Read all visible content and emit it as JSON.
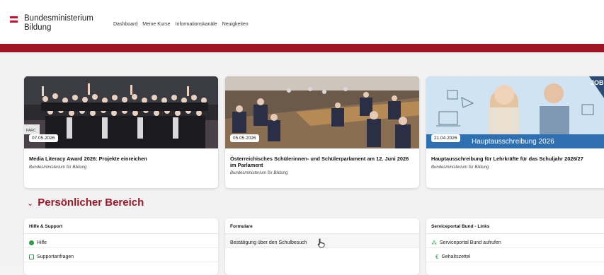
{
  "header": {
    "logo_line1": "Bundesministerium",
    "logo_line2": "Bildung",
    "nav": [
      "Dashboard",
      "Meine Kurse",
      "Informationskanäle",
      "Neuigkeiten"
    ]
  },
  "news": [
    {
      "date": "07.05.2026",
      "title": "Media Literacy Award 2026: Projekte einreichen",
      "source": "Bundesministerium für Bildung"
    },
    {
      "date": "05.05.2026",
      "title": "Österreichisches Schülerinnen- und Schülerparlament am 12. Juni 2026 im Parlament",
      "source": "Bundesministerium für Bildung"
    },
    {
      "date": "21.04.2026",
      "title": "Hauptausschreibung für Lehrkräfte für das Schuljahr 2026/27",
      "source": "Bundesministerium für Bildung",
      "banner_text": "Hauptausschreibung 2026",
      "corner_badge": "JOB"
    }
  ],
  "photo_labels": {
    "event_banner": "PARC"
  },
  "section_title": "Persönlicher Bereich",
  "panels": [
    {
      "title": "Hilfe & Support",
      "items": [
        "Hilfe",
        "Supportanfragen"
      ]
    },
    {
      "title": "Formulare",
      "items": [
        "Bestätigung über den Schulbesuch"
      ]
    },
    {
      "title": "Serviceportal Bund - Links",
      "items": [
        "Serviceportal Bund aufrufen",
        "Gehaltszettel"
      ]
    }
  ],
  "colors": {
    "brand_red": "#a01423",
    "accent_green": "#2e9e44"
  }
}
